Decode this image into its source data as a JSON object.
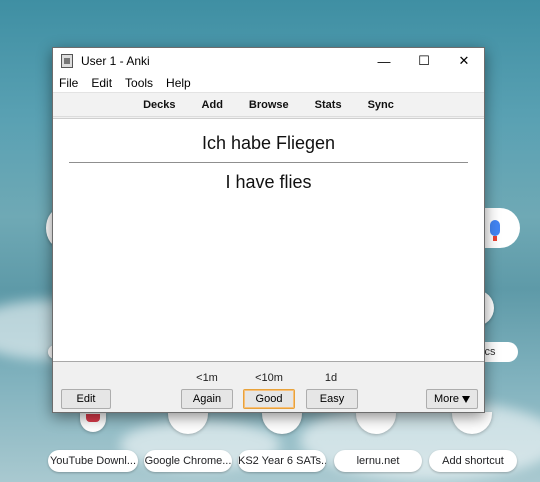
{
  "window": {
    "title": "User 1 - Anki",
    "controls": {
      "minimize": "—",
      "maximize": "☐",
      "close": "✕"
    }
  },
  "menu": [
    "File",
    "Edit",
    "Tools",
    "Help"
  ],
  "toolbar": [
    "Decks",
    "Add",
    "Browse",
    "Stats",
    "Sync"
  ],
  "card": {
    "front": "Ich habe Fliegen",
    "back": "I have flies"
  },
  "bottom": {
    "edit_label": "Edit",
    "answers": [
      {
        "interval": "<1m",
        "label": "Again"
      },
      {
        "interval": "<10m",
        "label": "Good"
      },
      {
        "interval": "1d",
        "label": "Easy"
      }
    ],
    "more_label": "More"
  },
  "background": {
    "partial_text": "ics",
    "shortcuts": [
      "YouTube Downl...",
      "Google Chrome...",
      "KS2 Year 6 SATs...",
      "lernu.net",
      "Add shortcut"
    ]
  },
  "colors": {
    "focus_border": "#e8a23b",
    "mic_blue": "#4285f4"
  }
}
